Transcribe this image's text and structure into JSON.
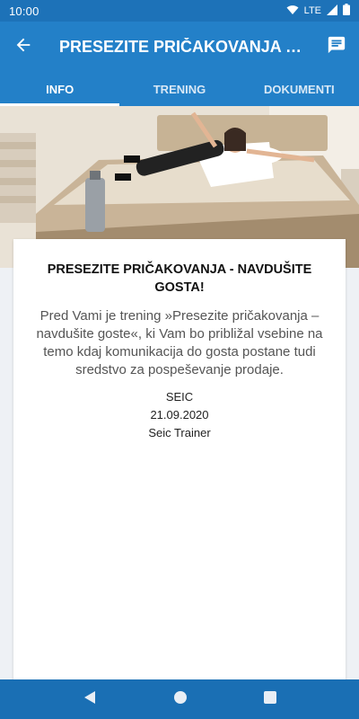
{
  "status_bar": {
    "time": "10:00",
    "network": "LTE"
  },
  "app_bar": {
    "title": "PRESEZITE PRIČAKOVANJA - N..."
  },
  "tabs": [
    {
      "label": "INFO",
      "active": true
    },
    {
      "label": "TRENING",
      "active": false
    },
    {
      "label": "DOKUMENTI",
      "active": false
    }
  ],
  "content": {
    "heading": "PRESEZITE PRIČAKOVANJA - NAVDUŠITE GOSTA!",
    "description": "Pred Vami je trening »Presezite pričakovanja – navdušite goste«, ki Vam bo približal vsebine na temo kdaj komunikacija do gosta postane tudi sredstvo za pospeševanje prodaje.",
    "organizer": "SEIC",
    "date": "21.09.2020",
    "trainer": "Seic Trainer"
  },
  "colors": {
    "primary": "#2380c8",
    "status_bar": "#1d72b8",
    "nav_bar": "#1a6fb4"
  },
  "icons": [
    "wifi-icon",
    "signal-icon",
    "battery-icon",
    "back-arrow-icon",
    "chat-icon",
    "nav-back-icon",
    "nav-home-icon",
    "nav-recents-icon"
  ]
}
